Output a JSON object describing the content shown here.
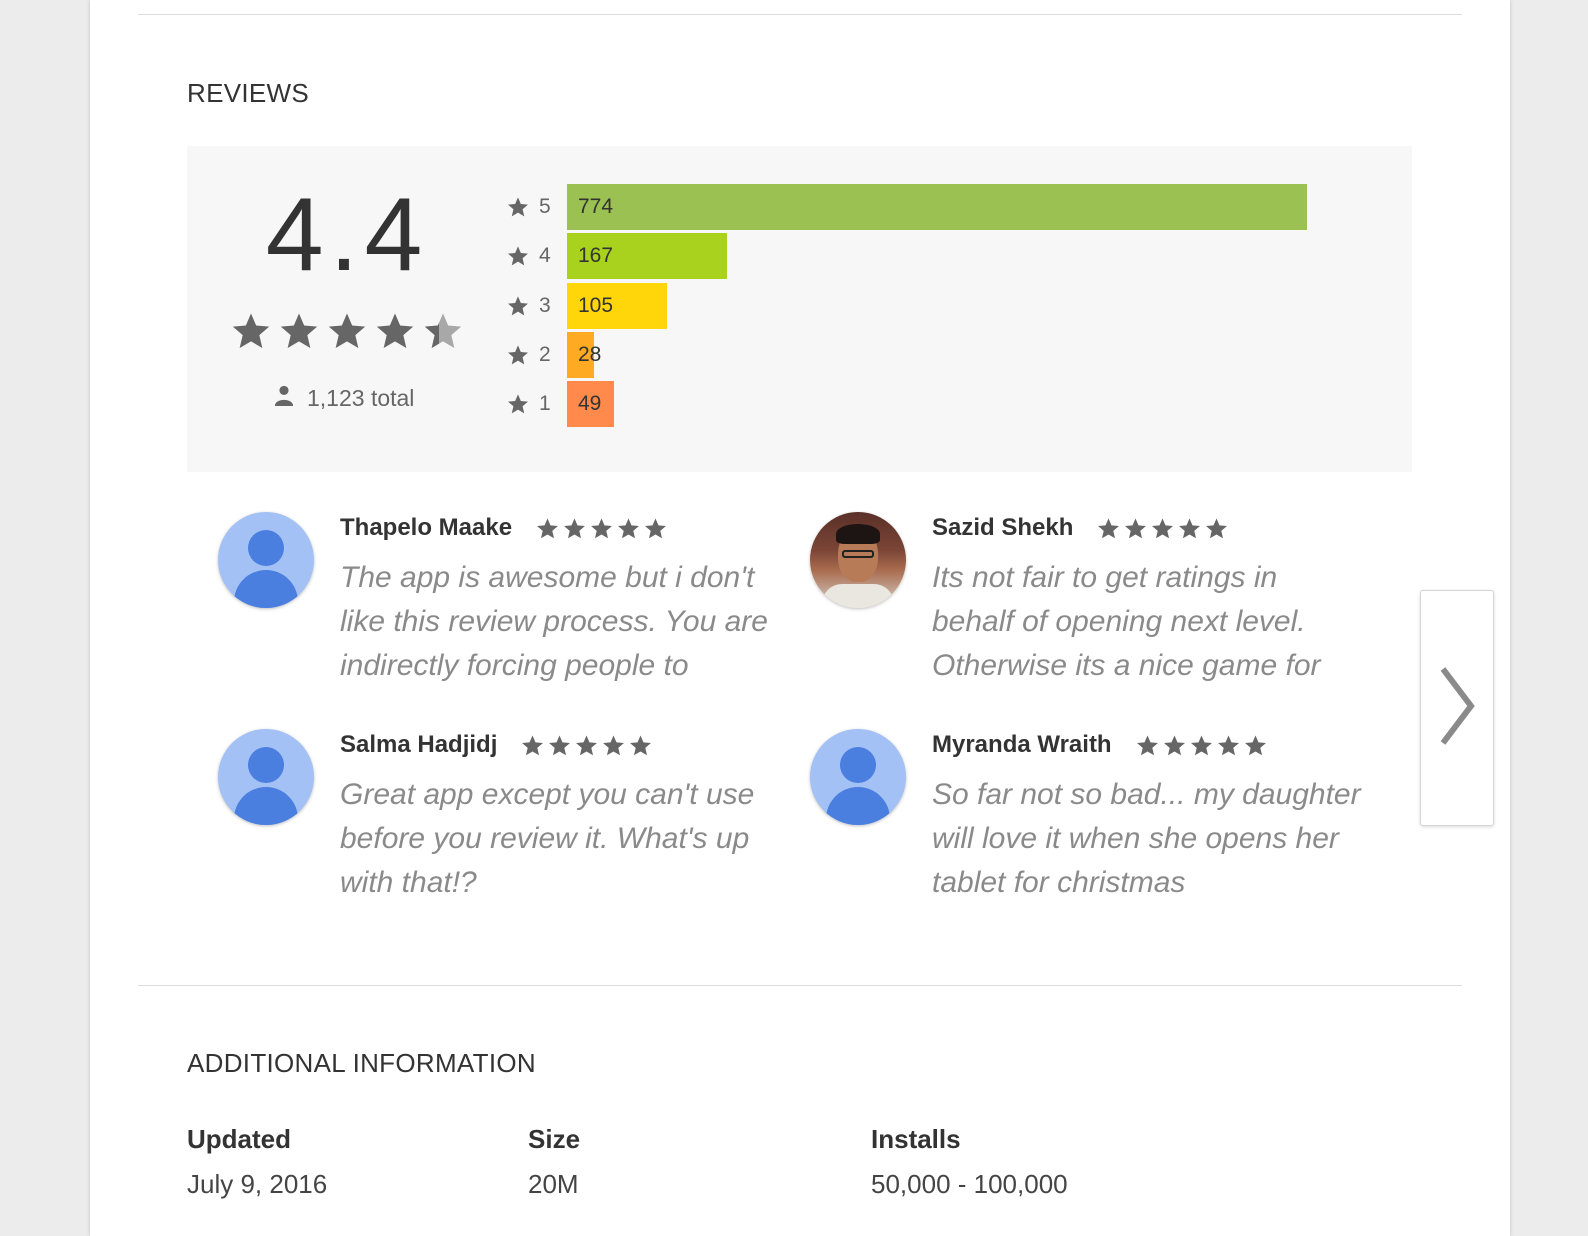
{
  "reviews_section": {
    "title": "REVIEWS",
    "average": "4.4",
    "average_stars": 4.4,
    "total": "1,123 total",
    "histogram": [
      {
        "star": "5",
        "count": "774",
        "value": 774,
        "color": "#9bc152"
      },
      {
        "star": "4",
        "count": "167",
        "value": 167,
        "color": "#a9d21e"
      },
      {
        "star": "3",
        "count": "105",
        "value": 105,
        "color": "#ffd60a"
      },
      {
        "star": "2",
        "count": "28",
        "value": 28,
        "color": "#ffaa23"
      },
      {
        "star": "1",
        "count": "49",
        "value": 49,
        "color": "#ff8a4c"
      }
    ],
    "reviews": [
      {
        "name": "Thapelo Maake",
        "stars": 5,
        "text": "The app is awesome but i don't like this review process. You are indirectly forcing people to",
        "avatar": "default-avatar-icon"
      },
      {
        "name": "Sazid Shekh",
        "stars": 5,
        "text": "Its not fair to get ratings in behalf of opening next level. Otherwise its a nice game for",
        "avatar": "user-photo"
      },
      {
        "name": "Salma Hadjidj",
        "stars": 5,
        "text": "Great app except you can't use before you review it. What's up with that!?",
        "avatar": "default-avatar-icon"
      },
      {
        "name": "Myranda Wraith",
        "stars": 5,
        "text": "So far not so bad... my daughter will love it when she opens her tablet for christmas",
        "avatar": "default-avatar-icon"
      }
    ],
    "next_icon": "chevron-right-icon"
  },
  "additional_info": {
    "title": "ADDITIONAL INFORMATION",
    "fields": [
      {
        "label": "Updated",
        "value": "July 9, 2016"
      },
      {
        "label": "Size",
        "value": "20M"
      },
      {
        "label": "Installs",
        "value": "50,000 - 100,000"
      }
    ]
  },
  "colors": {
    "star": "#666666",
    "star_half": "#a8a8a8",
    "avatar_bg": "#a3c1f5",
    "avatar_fg": "#4a7fe0"
  }
}
